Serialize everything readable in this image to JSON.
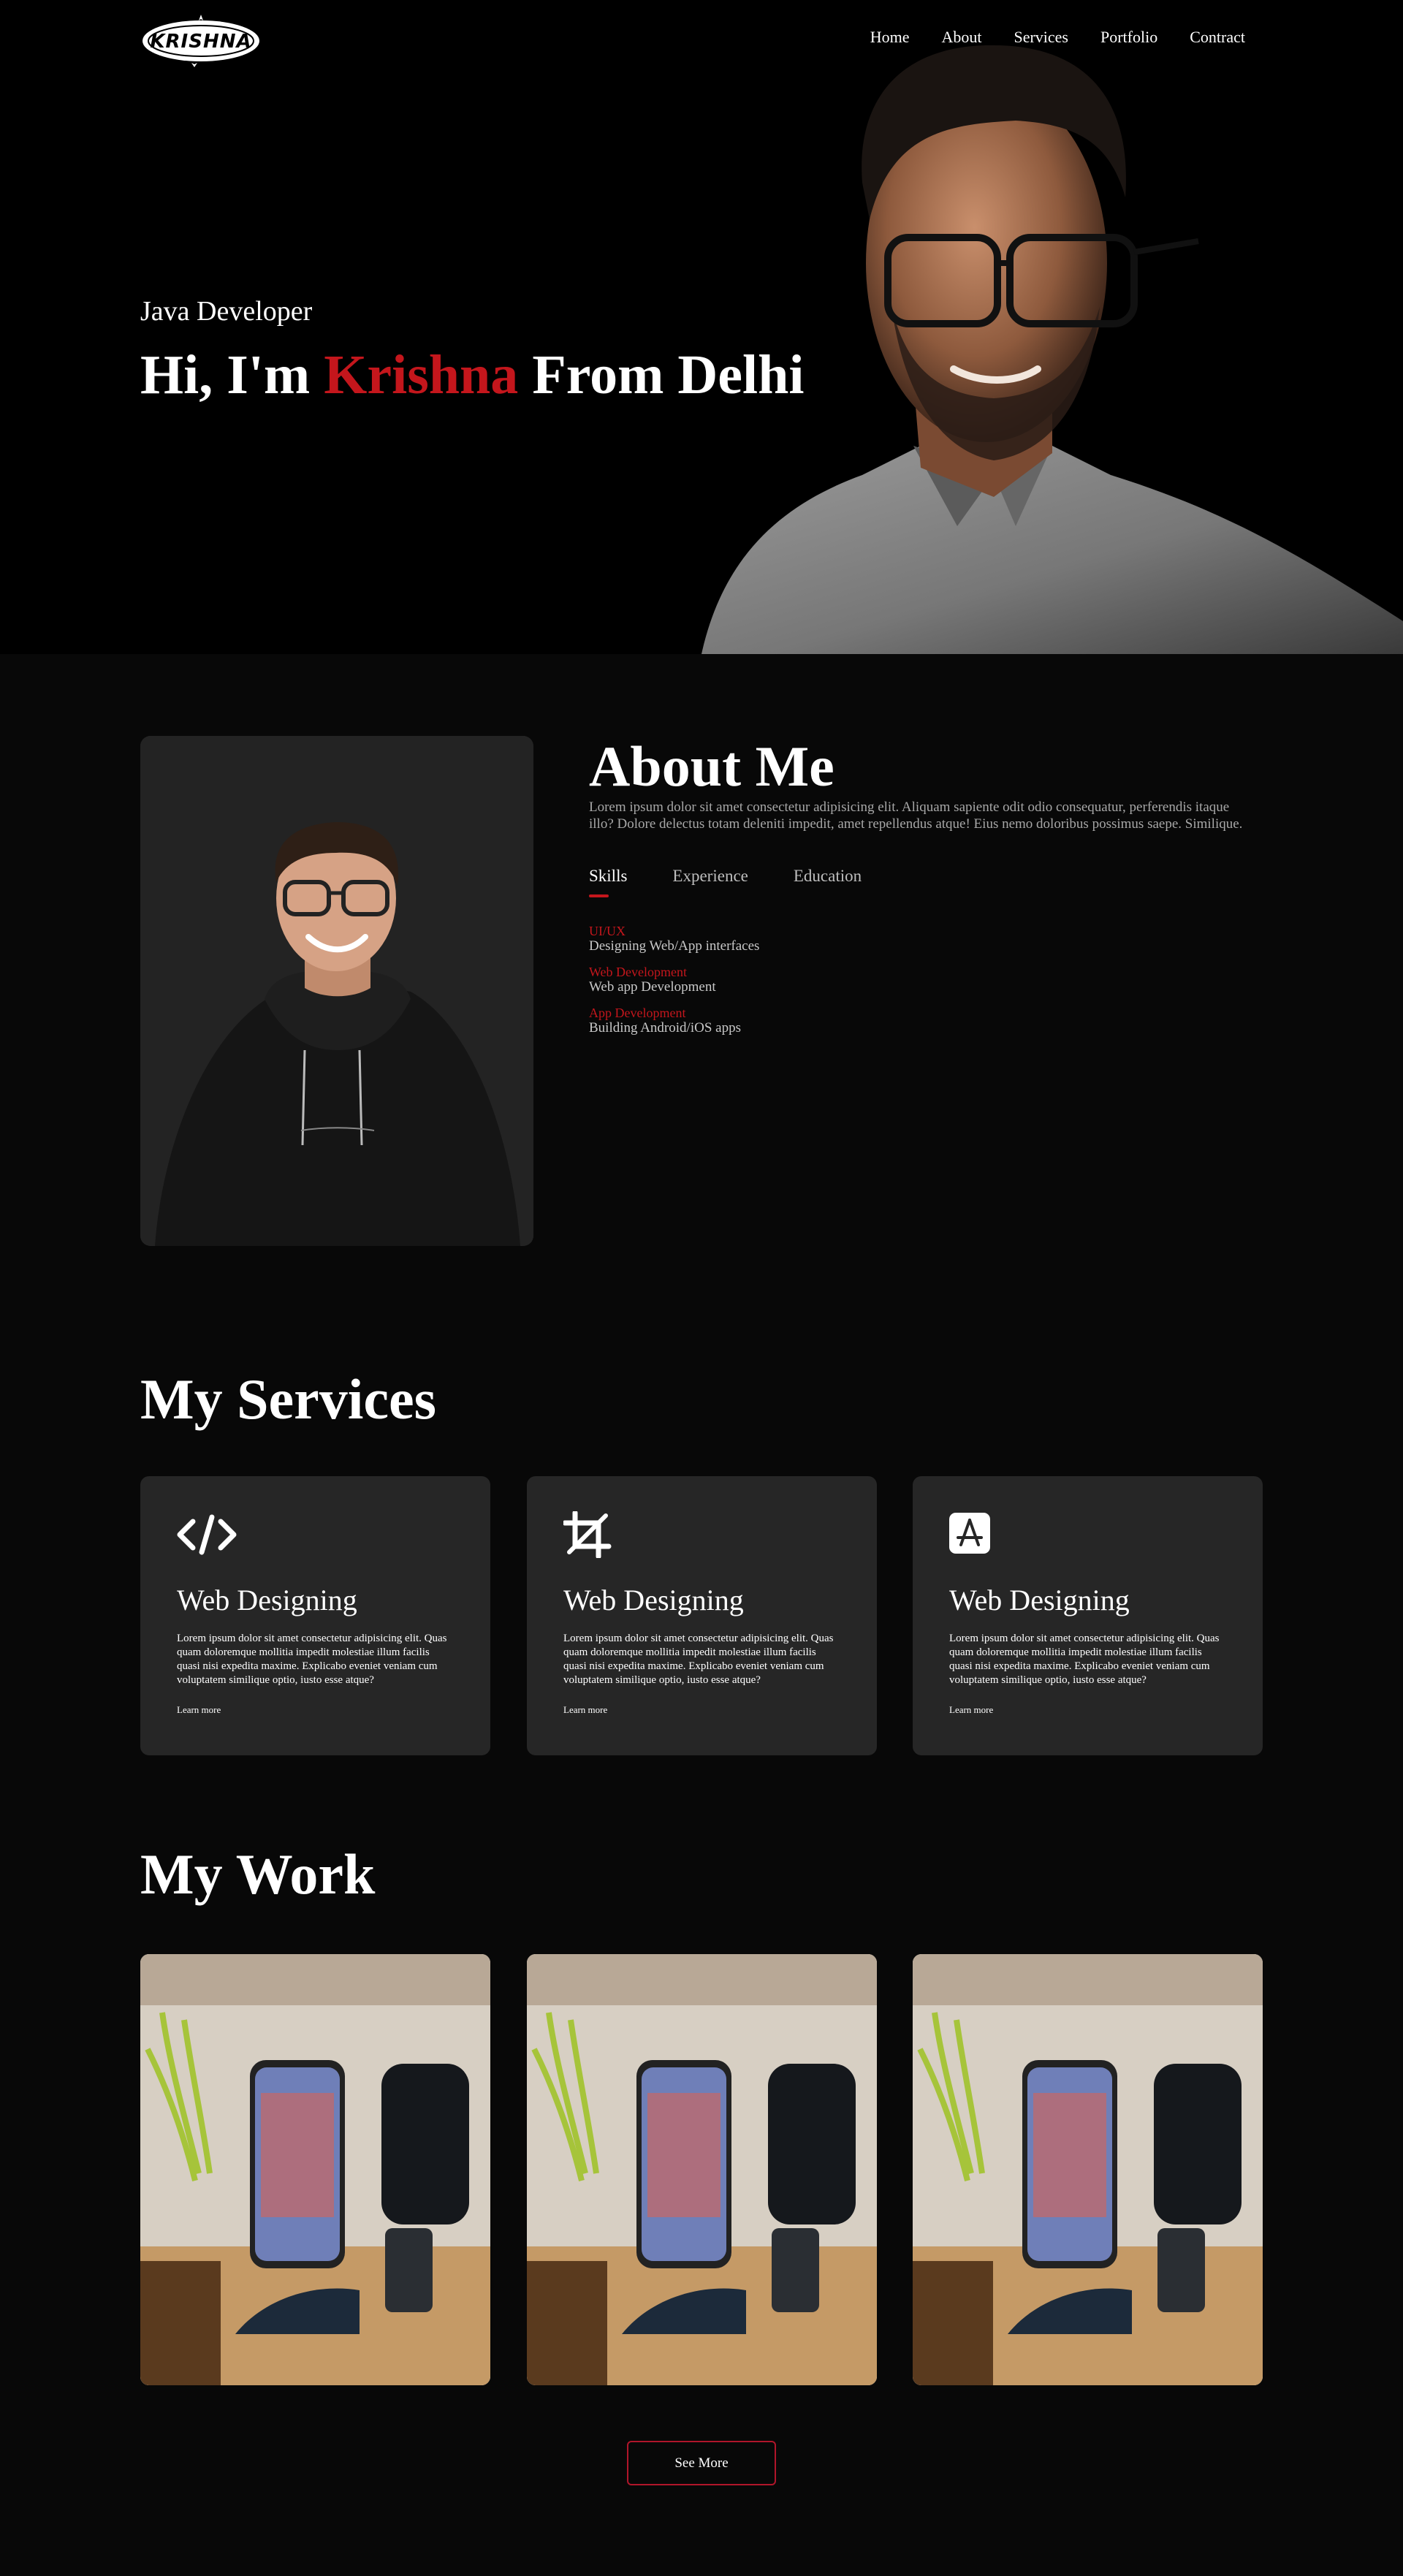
{
  "brand": {
    "logo_text": "KRISHNA"
  },
  "nav": {
    "items": [
      {
        "label": "Home"
      },
      {
        "label": "About"
      },
      {
        "label": "Services"
      },
      {
        "label": "Portfolio"
      },
      {
        "label": "Contract"
      }
    ]
  },
  "hero": {
    "subtitle": "Java Developer",
    "title_prefix": "Hi, I'm ",
    "title_name": "Krishna",
    "title_suffix": " From Delhi"
  },
  "about": {
    "title": "About Me",
    "text": "Lorem ipsum dolor sit amet consectetur adipisicing elit. Aliquam sapiente odit odio consequatur, perferendis itaque illo? Dolore delectus totam deleniti impedit, amet repellendus atque! Eius nemo doloribus possimus saepe. Similique.",
    "tabs": [
      {
        "label": "Skills",
        "active": true
      },
      {
        "label": "Experience",
        "active": false
      },
      {
        "label": "Education",
        "active": false
      }
    ],
    "skills": [
      {
        "name": "UI/UX",
        "desc": "Designing Web/App interfaces"
      },
      {
        "name": "Web Development",
        "desc": "Web app Development"
      },
      {
        "name": "App Development",
        "desc": "Building Android/iOS apps"
      }
    ]
  },
  "services": {
    "title": "My Services",
    "cards": [
      {
        "icon": "code-icon",
        "name": "Web Designing",
        "desc": "Lorem ipsum dolor sit amet consectetur adipisicing elit. Quas quam doloremque mollitia impedit molestiae illum facilis quasi nisi expedita maxime. Explicabo eveniet veniam cum voluptatem similique optio, iusto esse atque?",
        "link": "Learn more"
      },
      {
        "icon": "crop-icon",
        "name": "Web Designing",
        "desc": "Lorem ipsum dolor sit amet consectetur adipisicing elit. Quas quam doloremque mollitia impedit molestiae illum facilis quasi nisi expedita maxime. Explicabo eveniet veniam cum voluptatem similique optio, iusto esse atque?",
        "link": "Learn more"
      },
      {
        "icon": "app-store-icon",
        "name": "Web Designing",
        "desc": "Lorem ipsum dolor sit amet consectetur adipisicing elit. Quas quam doloremque mollitia impedit molestiae illum facilis quasi nisi expedita maxime. Explicabo eveniet veniam cum voluptatem similique optio, iusto esse atque?",
        "link": "Learn more"
      }
    ]
  },
  "work": {
    "title": "My Work",
    "see_more": "See More"
  },
  "colors": {
    "accent": "#c4161c",
    "background": "#080808",
    "card": "#262626"
  }
}
